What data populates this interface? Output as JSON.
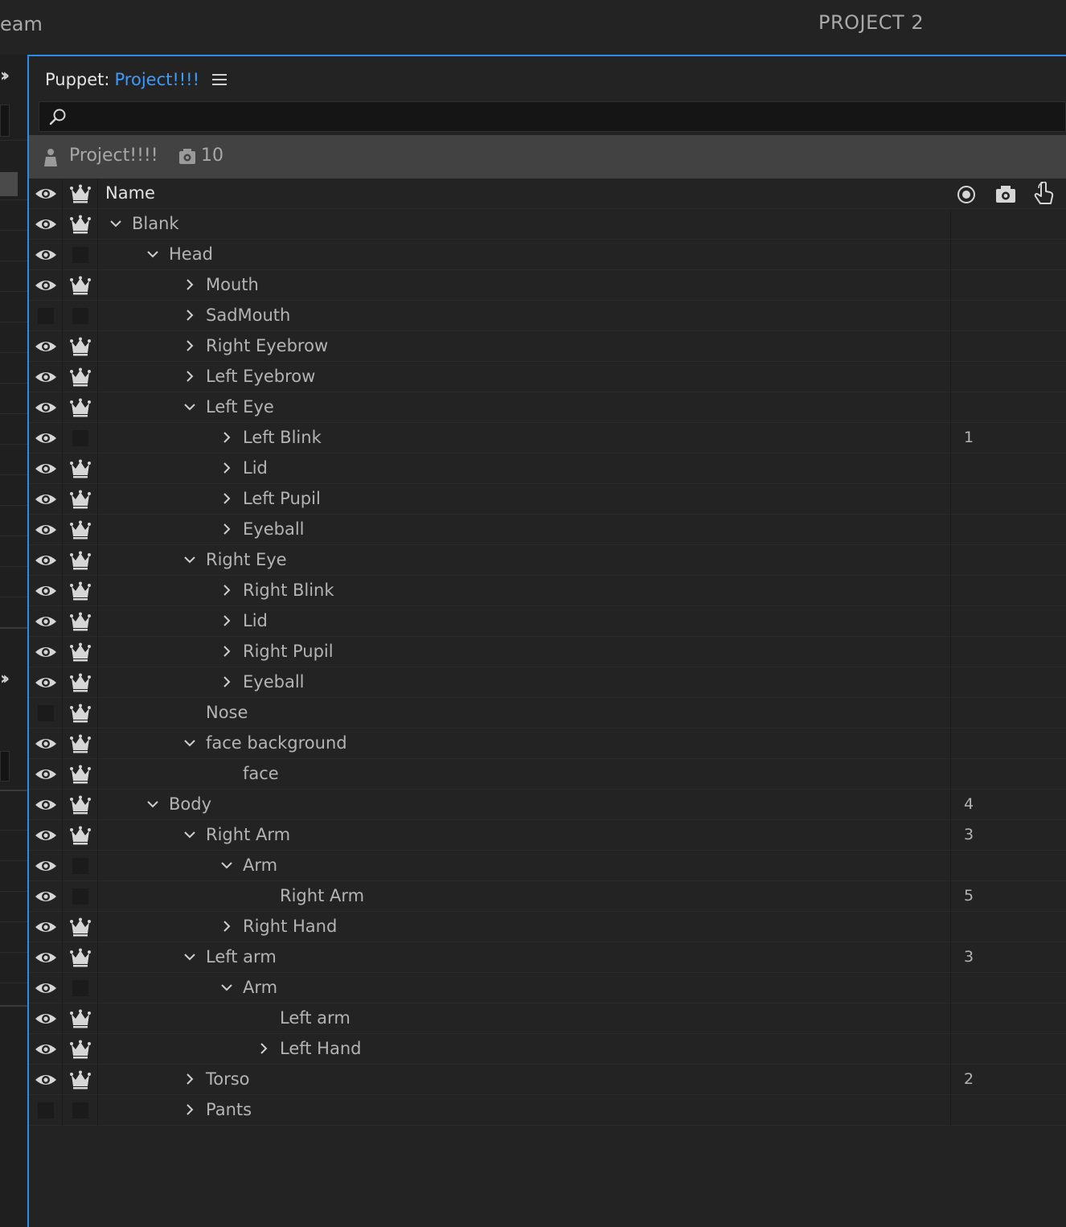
{
  "top_bar": {
    "left_text": "eam",
    "right_text": "PROJECT 2"
  },
  "panel": {
    "title_prefix": "Puppet:",
    "puppet_name": "Project!!!!",
    "search_placeholder": ""
  },
  "project_bar": {
    "name": "Project!!!!",
    "camera_count": "10"
  },
  "table_header": {
    "name_label": "Name",
    "icons": [
      "eye-icon",
      "crown-icon",
      "record-icon",
      "camera-icon",
      "touch-icon"
    ]
  },
  "rows": [
    {
      "name": "Blank",
      "depth": 0,
      "twisty": "open",
      "eye": true,
      "crown": true,
      "tag": ""
    },
    {
      "name": "Head",
      "depth": 1,
      "twisty": "open",
      "eye": true,
      "crown": false,
      "tag": ""
    },
    {
      "name": "Mouth",
      "depth": 2,
      "twisty": "closed",
      "eye": true,
      "crown": true,
      "tag": ""
    },
    {
      "name": "SadMouth",
      "depth": 2,
      "twisty": "closed",
      "eye": false,
      "crown": false,
      "tag": ""
    },
    {
      "name": "Right Eyebrow",
      "depth": 2,
      "twisty": "closed",
      "eye": true,
      "crown": true,
      "tag": ""
    },
    {
      "name": "Left Eyebrow",
      "depth": 2,
      "twisty": "closed",
      "eye": true,
      "crown": true,
      "tag": ""
    },
    {
      "name": "Left Eye",
      "depth": 2,
      "twisty": "open",
      "eye": true,
      "crown": true,
      "tag": ""
    },
    {
      "name": "Left Blink",
      "depth": 3,
      "twisty": "closed",
      "eye": true,
      "crown": false,
      "tag": "1"
    },
    {
      "name": "Lid",
      "depth": 3,
      "twisty": "closed",
      "eye": true,
      "crown": true,
      "tag": ""
    },
    {
      "name": "Left Pupil",
      "depth": 3,
      "twisty": "closed",
      "eye": true,
      "crown": true,
      "tag": ""
    },
    {
      "name": "Eyeball",
      "depth": 3,
      "twisty": "closed",
      "eye": true,
      "crown": true,
      "tag": ""
    },
    {
      "name": "Right Eye",
      "depth": 2,
      "twisty": "open",
      "eye": true,
      "crown": true,
      "tag": ""
    },
    {
      "name": "Right Blink",
      "depth": 3,
      "twisty": "closed",
      "eye": true,
      "crown": true,
      "tag": ""
    },
    {
      "name": "Lid",
      "depth": 3,
      "twisty": "closed",
      "eye": true,
      "crown": true,
      "tag": ""
    },
    {
      "name": "Right Pupil",
      "depth": 3,
      "twisty": "closed",
      "eye": true,
      "crown": true,
      "tag": ""
    },
    {
      "name": "Eyeball",
      "depth": 3,
      "twisty": "closed",
      "eye": true,
      "crown": true,
      "tag": ""
    },
    {
      "name": "Nose",
      "depth": 2,
      "twisty": "none",
      "eye": false,
      "crown": true,
      "tag": ""
    },
    {
      "name": "face background",
      "depth": 2,
      "twisty": "open",
      "eye": true,
      "crown": true,
      "tag": ""
    },
    {
      "name": "face",
      "depth": 3,
      "twisty": "none",
      "eye": true,
      "crown": true,
      "tag": ""
    },
    {
      "name": "Body",
      "depth": 1,
      "twisty": "open",
      "eye": true,
      "crown": true,
      "tag": "4"
    },
    {
      "name": "Right Arm",
      "depth": 2,
      "twisty": "open",
      "eye": true,
      "crown": true,
      "tag": "3"
    },
    {
      "name": "Arm",
      "depth": 3,
      "twisty": "open",
      "eye": true,
      "crown": false,
      "tag": ""
    },
    {
      "name": "Right Arm",
      "depth": 4,
      "twisty": "none",
      "eye": true,
      "crown": false,
      "tag": "5"
    },
    {
      "name": "Right Hand",
      "depth": 3,
      "twisty": "closed",
      "eye": true,
      "crown": true,
      "tag": ""
    },
    {
      "name": "Left arm",
      "depth": 2,
      "twisty": "open",
      "eye": true,
      "crown": true,
      "tag": "3"
    },
    {
      "name": "Arm",
      "depth": 3,
      "twisty": "open",
      "eye": true,
      "crown": false,
      "tag": ""
    },
    {
      "name": "Left arm",
      "depth": 4,
      "twisty": "none",
      "eye": true,
      "crown": true,
      "tag": ""
    },
    {
      "name": "Left Hand",
      "depth": 4,
      "twisty": "closed",
      "eye": true,
      "crown": true,
      "tag": ""
    },
    {
      "name": "Torso",
      "depth": 2,
      "twisty": "closed",
      "eye": true,
      "crown": true,
      "tag": "2"
    },
    {
      "name": "Pants",
      "depth": 2,
      "twisty": "closed",
      "eye": false,
      "crown": false,
      "tag": ""
    }
  ],
  "colors": {
    "accent": "#2d8ceb",
    "puppet_name": "#3b9bff",
    "background": "#232323",
    "project_bar": "#424242"
  }
}
